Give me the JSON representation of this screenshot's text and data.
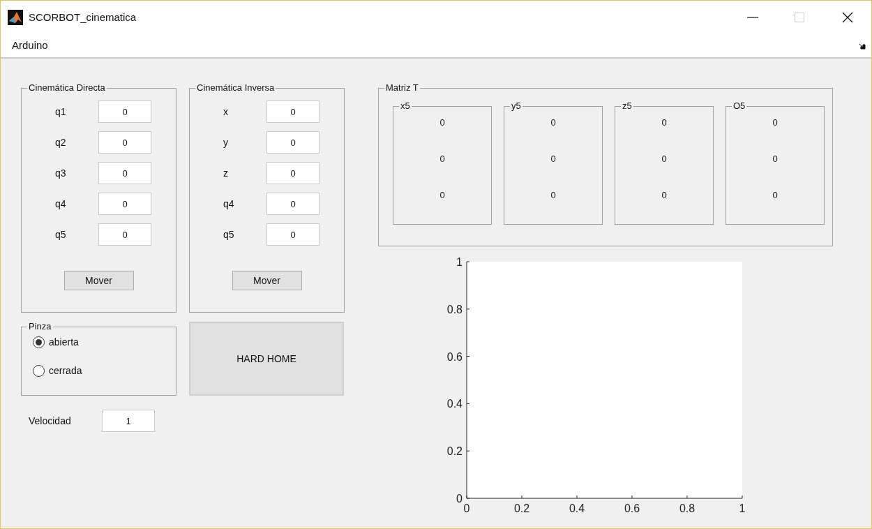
{
  "window": {
    "title": "SCORBOT_cinematica"
  },
  "menu": [
    "Arduino"
  ],
  "cinematica_directa": {
    "title": "Cinemática Directa",
    "fields": [
      {
        "label": "q1",
        "value": "0"
      },
      {
        "label": "q2",
        "value": "0"
      },
      {
        "label": "q3",
        "value": "0"
      },
      {
        "label": "q4",
        "value": "0"
      },
      {
        "label": "q5",
        "value": "0"
      }
    ],
    "button": "Mover"
  },
  "cinematica_inversa": {
    "title": "Cinemática Inversa",
    "fields": [
      {
        "label": "x",
        "value": "0"
      },
      {
        "label": "y",
        "value": "0"
      },
      {
        "label": "z",
        "value": "0"
      },
      {
        "label": "q4",
        "value": "0"
      },
      {
        "label": "q5",
        "value": "0"
      }
    ],
    "button": "Mover"
  },
  "pinza": {
    "title": "Pinza",
    "options": [
      {
        "label": "abierta",
        "selected": true
      },
      {
        "label": "cerrada",
        "selected": false
      }
    ]
  },
  "hard_home_button": "HARD HOME",
  "velocidad": {
    "label": "Velocidad",
    "value": "1"
  },
  "matriz_t": {
    "title": "Matriz T",
    "columns": [
      {
        "title": "x5",
        "values": [
          "0",
          "0",
          "0"
        ]
      },
      {
        "title": "y5",
        "values": [
          "0",
          "0",
          "0"
        ]
      },
      {
        "title": "z5",
        "values": [
          "0",
          "0",
          "0"
        ]
      },
      {
        "title": "O5",
        "values": [
          "0",
          "0",
          "0"
        ]
      }
    ]
  },
  "axes": {
    "chart_data": {
      "type": "line",
      "xlim": [
        0,
        1
      ],
      "ylim": [
        0,
        1
      ],
      "xticks": [
        0,
        0.2,
        0.4,
        0.6,
        0.8,
        1
      ],
      "yticks": [
        0,
        0.2,
        0.4,
        0.6,
        0.8,
        1
      ]
    }
  }
}
